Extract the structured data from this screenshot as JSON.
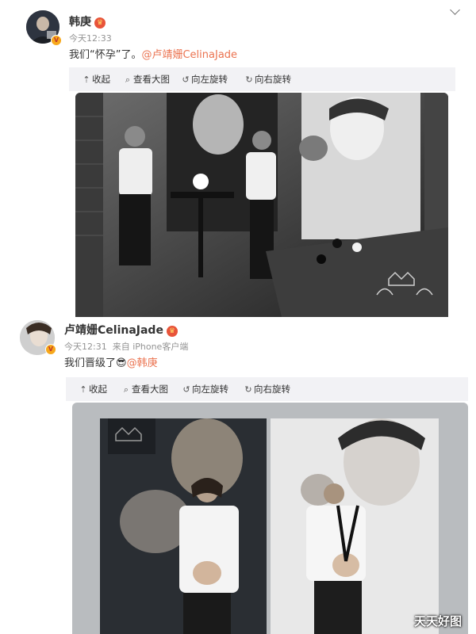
{
  "post1": {
    "username": "韩庚",
    "time": "今天12:33",
    "text_before": "我们“怀孕”了。",
    "mention": "@卢靖姗CelinaJade",
    "toolbar": {
      "collapse": "收起",
      "view_large": "查看大图",
      "rotate_left": "向左旋转",
      "rotate_right": "向右旋转"
    }
  },
  "post2": {
    "username": "卢靖姗CelinaJade",
    "time": "今天12:31",
    "source": "来自 iPhone客户端",
    "text_before": "我们晋级了",
    "emoji": "😎",
    "mention": "@韩庚",
    "toolbar": {
      "collapse": "收起",
      "view_large": "查看大图",
      "rotate_left": "向左旋转",
      "rotate_right": "向右旋转"
    }
  },
  "watermark": "天天好图",
  "colors": {
    "mention": "#eb7350",
    "toolbar_bg": "#f2f2f5",
    "meta": "#939393"
  },
  "icons": [
    "chevron-down-icon",
    "collapse-icon",
    "magnifier-icon",
    "rotate-left-icon",
    "rotate-right-icon",
    "verified-badge-icon",
    "crown-icon"
  ]
}
